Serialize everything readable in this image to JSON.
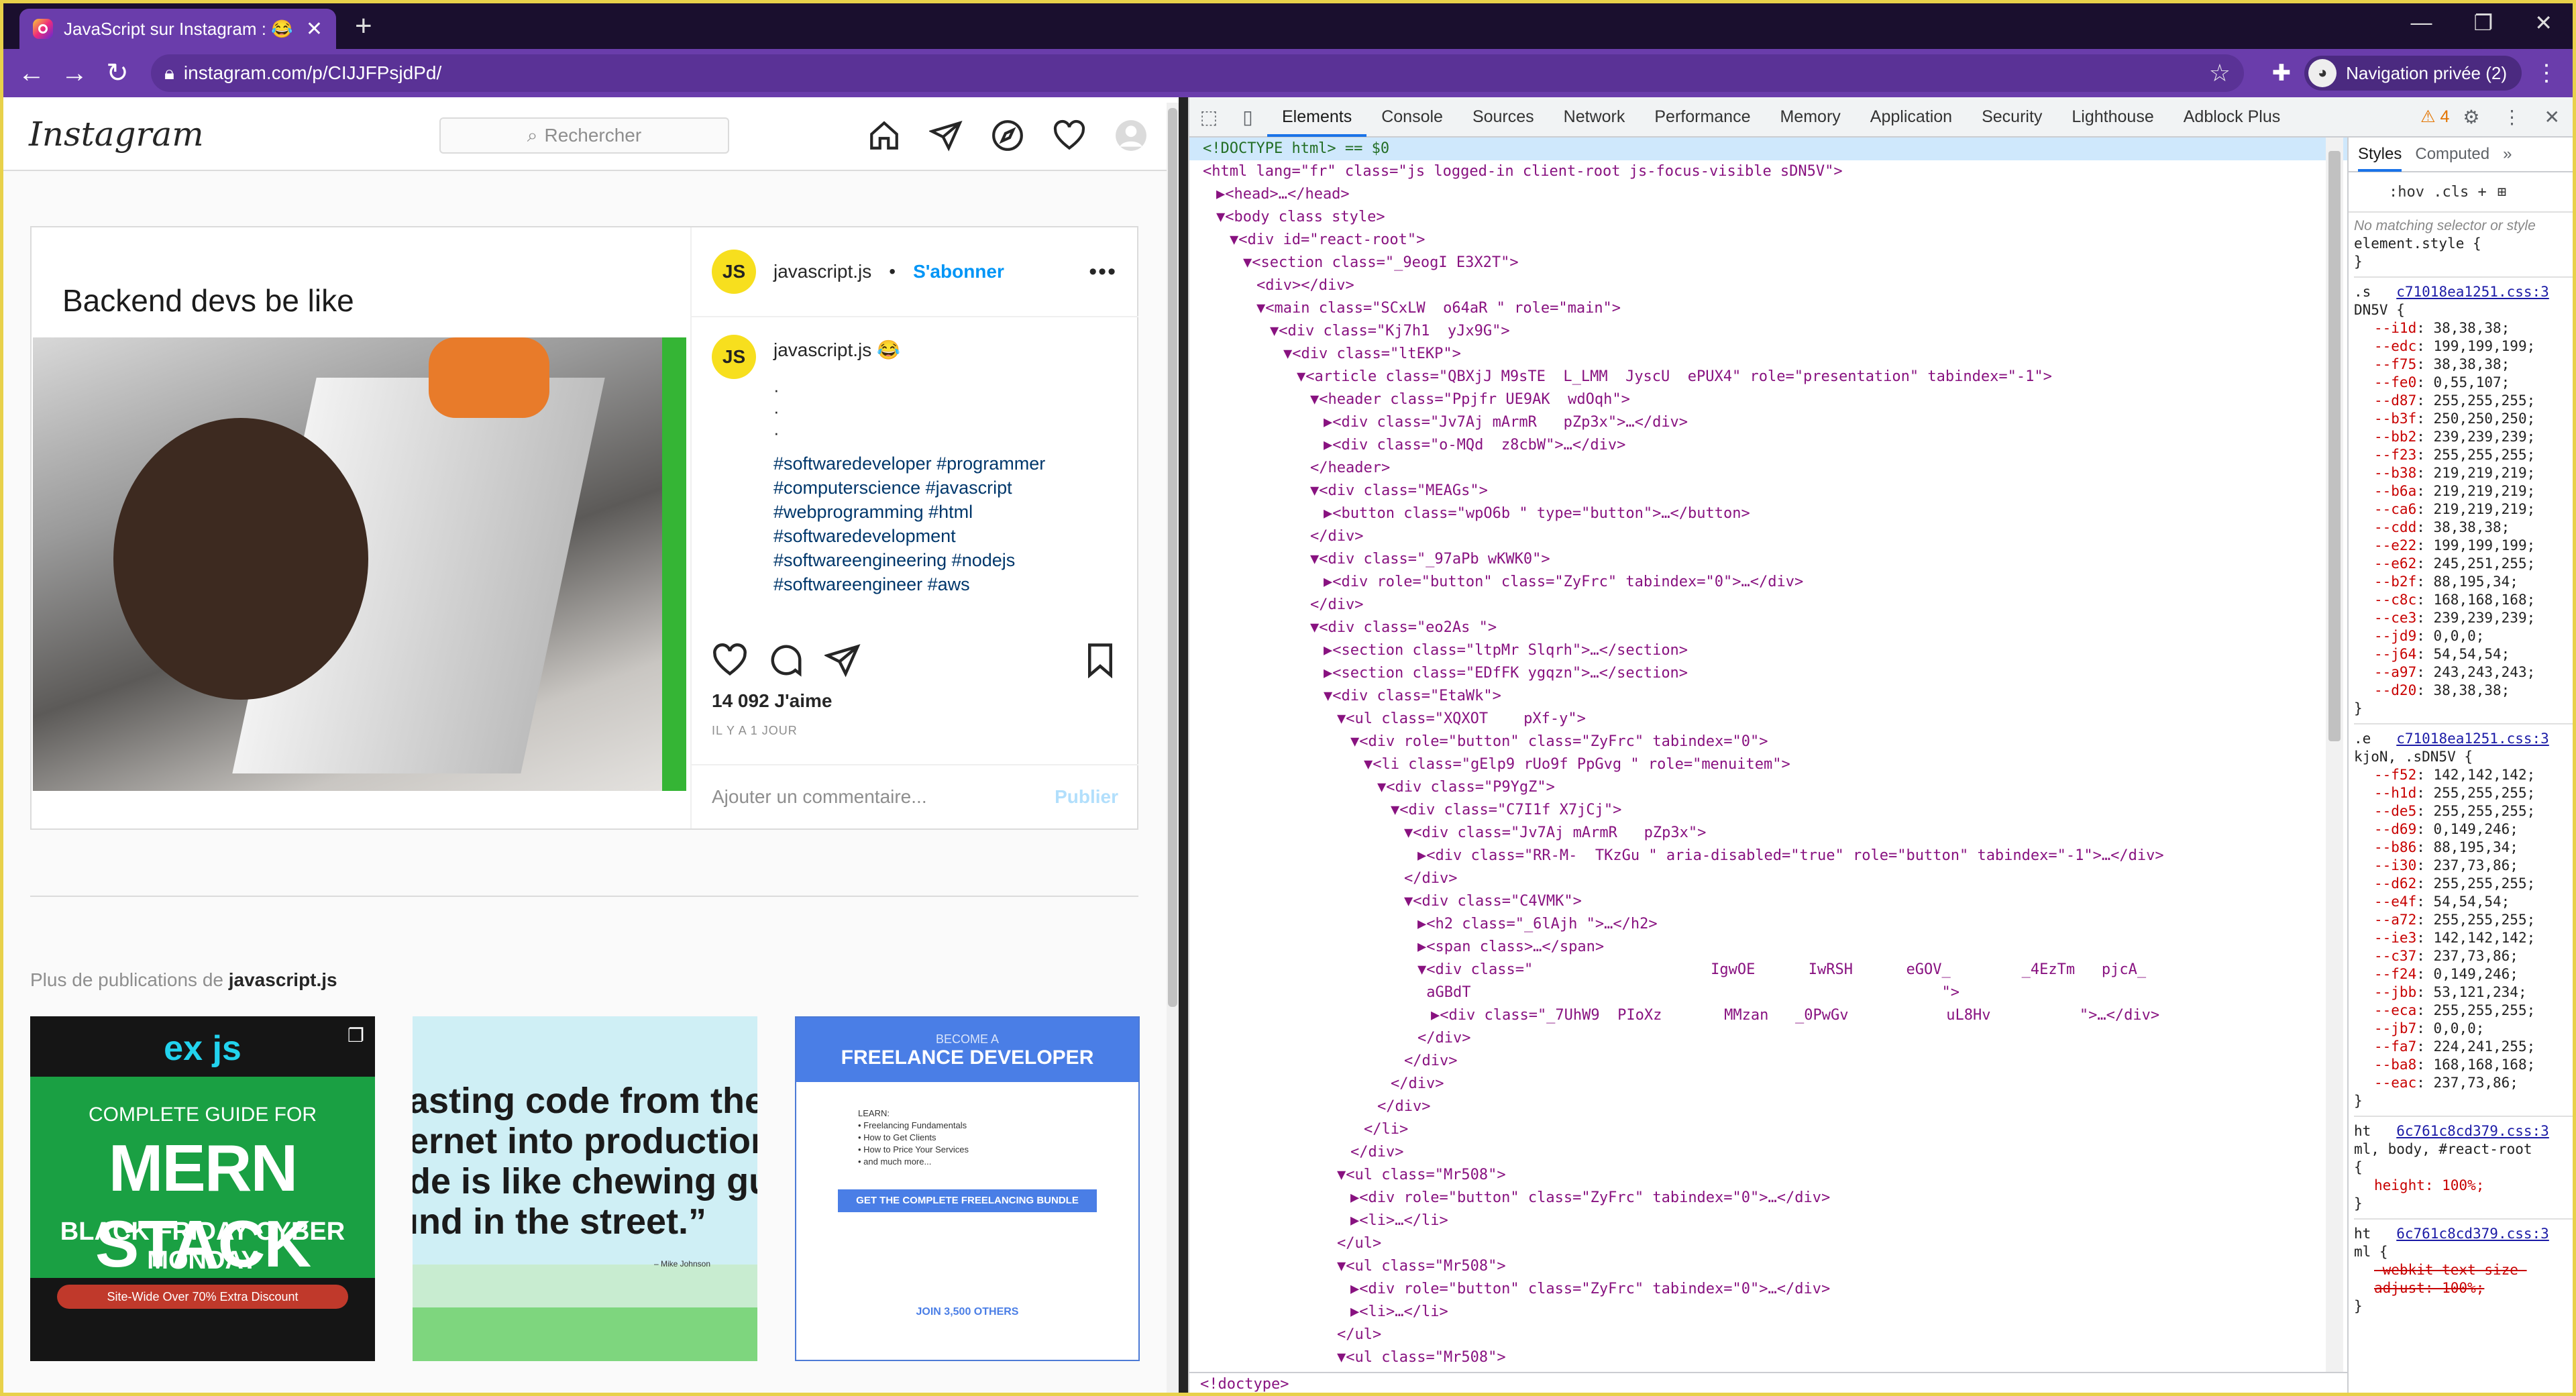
{
  "browser": {
    "tab_title": "JavaScript sur Instagram : 😂 ...",
    "url": "instagram.com/p/CIJJFPsjdPd/",
    "profile_label": "Navigation privée (2)"
  },
  "instagram": {
    "logo": "Instagram",
    "search_placeholder": "Rechercher",
    "post": {
      "caption_image": "Backend devs be like",
      "author": "javascript.js",
      "avatar_text": "JS",
      "follow": "S'abonner",
      "comment_author": "javascript.js 😂",
      "dots": [
        "·",
        "·",
        "·"
      ],
      "hashtags": [
        "#softwaredeveloper #programmer",
        "#computerscience #javascript",
        "#webprogramming #html",
        "#softwaredevelopment",
        "#softwareengineering #nodejs",
        "#softwareengineer #aws"
      ],
      "likes": "14 092 J'aime",
      "time_ago": "IL Y A 1 JOUR",
      "comment_placeholder": "Ajouter un commentaire...",
      "publish": "Publier"
    },
    "more_prefix": "Plus de publications de ",
    "more_user": "javascript.js",
    "thumbs": {
      "t1_top": "ex  js",
      "t1_subtitle": "COMPLETE GUIDE FOR",
      "t1_title": "MERN STACK",
      "t1_promo": "BLACK FRIDAY CYBER MONDAY",
      "t1_offer": "Site-Wide Over 70% Extra Discount",
      "t2_quote": "asting code from the\nernet into production\nde is like chewing gu\nınd in the street.”",
      "t2_author": "– Mike Johnson",
      "t3_small": "BECOME A",
      "t3_title": "FREELANCE DEVELOPER",
      "t3_list": "LEARN:\n• Freelancing Fundamentals\n• How to Get Clients\n• How to Price Your Services\n• and much more...",
      "t3_cta": "GET THE COMPLETE FREELANCING BUNDLE",
      "t3_footer": "JOIN 3,500 OTHERS"
    }
  },
  "devtools": {
    "tabs": [
      "Elements",
      "Console",
      "Sources",
      "Network",
      "Performance",
      "Memory",
      "Application",
      "Security",
      "Lighthouse",
      "Adblock Plus"
    ],
    "active_tab": "Elements",
    "warnings": "⚠ 4",
    "breadcrumb": "<!doctype>",
    "dom_lines": [
      {
        "i": 0,
        "t": "<!DOCTYPE html> == $0",
        "sel": true,
        "cm": true
      },
      {
        "i": 0,
        "t": "<html lang=\"fr\" class=\"js logged-in client-root js-focus-visible sDN5V\">"
      },
      {
        "i": 1,
        "t": "▶<head>…</head>"
      },
      {
        "i": 1,
        "t": "▼<body class style>"
      },
      {
        "i": 2,
        "t": "▼<div id=\"react-root\">"
      },
      {
        "i": 3,
        "t": "▼<section class=\"_9eogI E3X2T\">"
      },
      {
        "i": 4,
        "t": "<div></div>"
      },
      {
        "i": 4,
        "t": "▼<main class=\"SCxLW  o64aR \" role=\"main\">"
      },
      {
        "i": 5,
        "t": "▼<div class=\"Kj7h1  yJx9G\">"
      },
      {
        "i": 6,
        "t": "▼<div class=\"ltEKP\">"
      },
      {
        "i": 7,
        "t": "▼<article class=\"QBXjJ M9sTE  L_LMM  JyscU  ePUX4\" role=\"presentation\" tabindex=\"-1\">"
      },
      {
        "i": 8,
        "t": "▼<header class=\"Ppjfr UE9AK  wdOqh\">"
      },
      {
        "i": 9,
        "t": "▶<div class=\"Jv7Aj mArmR   pZp3x\">…</div>"
      },
      {
        "i": 9,
        "t": "▶<div class=\"o-MQd  z8cbW\">…</div>"
      },
      {
        "i": 8,
        "t": "</header>"
      },
      {
        "i": 8,
        "t": "▼<div class=\"MEAGs\">"
      },
      {
        "i": 9,
        "t": "▶<button class=\"wpO6b \" type=\"button\">…</button>"
      },
      {
        "i": 8,
        "t": "</div>"
      },
      {
        "i": 8,
        "t": "▼<div class=\"_97aPb wKWK0\">"
      },
      {
        "i": 9,
        "t": "▶<div role=\"button\" class=\"ZyFrc\" tabindex=\"0\">…</div>"
      },
      {
        "i": 8,
        "t": "</div>"
      },
      {
        "i": 8,
        "t": "▼<div class=\"eo2As \">"
      },
      {
        "i": 9,
        "t": "▶<section class=\"ltpMr Slqrh\">…</section>"
      },
      {
        "i": 9,
        "t": "▶<section class=\"EDfFK ygqzn\">…</section>"
      },
      {
        "i": 9,
        "t": "▼<div class=\"EtaWk\">"
      },
      {
        "i": 10,
        "t": "▼<ul class=\"XQXOT    pXf-y\">"
      },
      {
        "i": 11,
        "t": "▼<div role=\"button\" class=\"ZyFrc\" tabindex=\"0\">"
      },
      {
        "i": 12,
        "t": "▼<li class=\"gElp9 rUo9f PpGvg \" role=\"menuitem\">"
      },
      {
        "i": 13,
        "t": "▼<div class=\"P9YgZ\">"
      },
      {
        "i": 14,
        "t": "▼<div class=\"C7I1f X7jCj\">"
      },
      {
        "i": 15,
        "t": "▼<div class=\"Jv7Aj mArmR   pZp3x\">"
      },
      {
        "i": 16,
        "t": "▶<div class=\"RR-M-  TKzGu \" aria-disabled=\"true\" role=\"button\" tabindex=\"-1\">…</div>"
      },
      {
        "i": 15,
        "t": "</div>"
      },
      {
        "i": 15,
        "t": "▼<div class=\"C4VMK\">"
      },
      {
        "i": 16,
        "t": "▶<h2 class=\"_6lAjh \">…</h2>"
      },
      {
        "i": 16,
        "t": "▶<span class>…</span>"
      },
      {
        "i": 16,
        "t": "▼<div class=\"                    IgwOE      IwRSH      eGOV_        _4EzTm   pjcA_"
      },
      {
        "i": 16,
        "t": " aGBdT                                                     \">"
      },
      {
        "i": 17,
        "t": "▶<div class=\"_7UhW9  PIoXz       MMzan   _0PwGv           uL8Hv          \">…</div>"
      },
      {
        "i": 16,
        "t": "</div>"
      },
      {
        "i": 15,
        "t": "</div>"
      },
      {
        "i": 14,
        "t": "</div>"
      },
      {
        "i": 13,
        "t": "</div>"
      },
      {
        "i": 12,
        "t": "</li>"
      },
      {
        "i": 11,
        "t": "</div>"
      },
      {
        "i": 10,
        "t": "▼<ul class=\"Mr508\">"
      },
      {
        "i": 11,
        "t": "▶<div role=\"button\" class=\"ZyFrc\" tabindex=\"0\">…</div>"
      },
      {
        "i": 11,
        "t": "▶<li>…</li>"
      },
      {
        "i": 10,
        "t": "</ul>"
      },
      {
        "i": 10,
        "t": "▼<ul class=\"Mr508\">"
      },
      {
        "i": 11,
        "t": "▶<div role=\"button\" class=\"ZyFrc\" tabindex=\"0\">…</div>"
      },
      {
        "i": 11,
        "t": "▶<li>…</li>"
      },
      {
        "i": 10,
        "t": "</ul>"
      },
      {
        "i": 10,
        "t": "▼<ul class=\"Mr508\">"
      }
    ],
    "styles": {
      "tabs": [
        "Styles",
        "Computed"
      ],
      "filter": ":hov  .cls  +",
      "no_match": "No matching selector or style",
      "element_style": "element.style {",
      "rule1_sel": ".s",
      "rule1_src": "c71018ea1251.css:3",
      "rule1_sel2": "DN5V {",
      "rule1_props": [
        [
          "--i1d",
          "38,38,38;"
        ],
        [
          "--edc",
          "199,199,199;"
        ],
        [
          "--f75",
          "38,38,38;"
        ],
        [
          "--fe0",
          "0,55,107;"
        ],
        [
          "--d87",
          "255,255,255;"
        ],
        [
          "--b3f",
          "250,250,250;"
        ],
        [
          "--bb2",
          "239,239,239;"
        ],
        [
          "--f23",
          "255,255,255;"
        ],
        [
          "--b38",
          "219,219,219;"
        ],
        [
          "--b6a",
          "219,219,219;"
        ],
        [
          "--ca6",
          "219,219,219;"
        ],
        [
          "--cdd",
          "38,38,38;"
        ],
        [
          "--e22",
          "199,199,199;"
        ],
        [
          "--e62",
          "245,251,255;"
        ],
        [
          "--b2f",
          "88,195,34;"
        ],
        [
          "--c8c",
          "168,168,168;"
        ],
        [
          "--ce3",
          "239,239,239;"
        ],
        [
          "--jd9",
          "0,0,0;"
        ],
        [
          "--j64",
          "54,54,54;"
        ],
        [
          "--a97",
          "243,243,243;"
        ],
        [
          "--d20",
          "38,38,38;"
        ]
      ],
      "rule2_sel": ".e",
      "rule2_src": "c71018ea1251.css:3",
      "rule2_sel2": "kjoN, .sDN5V {",
      "rule2_props": [
        [
          "--f52",
          "142,142,142;"
        ],
        [
          "--h1d",
          "255,255,255;"
        ],
        [
          "--de5",
          "255,255,255;"
        ],
        [
          "--d69",
          "0,149,246;"
        ],
        [
          "--b86",
          "88,195,34;"
        ],
        [
          "--i30",
          "237,73,86;"
        ],
        [
          "--d62",
          "255,255,255;"
        ],
        [
          "--e4f",
          "54,54,54;"
        ],
        [
          "--a72",
          "255,255,255;"
        ],
        [
          "--ie3",
          "142,142,142;"
        ],
        [
          "--c37",
          "237,73,86;"
        ],
        [
          "--f24",
          "0,149,246;"
        ],
        [
          "--jbb",
          "53,121,234;"
        ],
        [
          "--eca",
          "255,255,255;"
        ],
        [
          "--jb7",
          "0,0,0;"
        ],
        [
          "--fa7",
          "224,241,255;"
        ],
        [
          "--ba8",
          "168,168,168;"
        ],
        [
          "--eac",
          "237,73,86;"
        ]
      ],
      "rule3_sel": "ht",
      "rule3_src": "6c761c8cd379.css:3",
      "rule3_sel2": "ml, body, #react-root",
      "rule3_prop": "height: 100%;",
      "rule4_sel": "ht",
      "rule4_src": "6c761c8cd379.css:3",
      "rule4_sel2": "ml {",
      "rule4_strike": "-webkit-text-size-adjust: 100%;"
    }
  }
}
